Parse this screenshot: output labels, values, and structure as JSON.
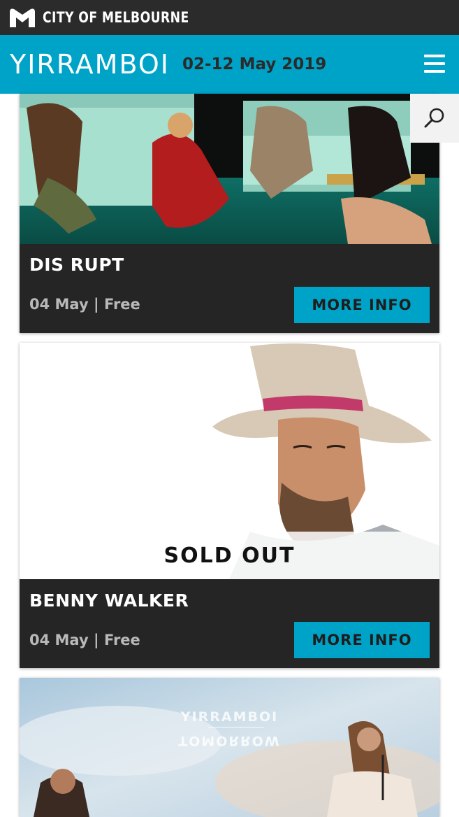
{
  "topbar": {
    "org_name": "CITY OF MELBOURNE"
  },
  "header": {
    "logo_text": "YIRRAMBOI",
    "dates": "02-12 May 2019"
  },
  "events": [
    {
      "title": "DIS RUPT",
      "meta": "04 May | Free",
      "button_label": "MORE INFO",
      "status": ""
    },
    {
      "title": "BENNY WALKER",
      "meta": "04 May | Free",
      "button_label": "MORE INFO",
      "status": "SOLD OUT"
    },
    {
      "image_caption_top": "YIRRAMBOI",
      "image_caption_bottom": "TOMORROW"
    }
  ],
  "colors": {
    "accent": "#00a3c8",
    "dark": "#252525",
    "topbar": "#2b2b2b"
  },
  "icons": {
    "menu": "hamburger-icon",
    "search": "search-icon",
    "logo": "city-of-melbourne-m-icon"
  }
}
